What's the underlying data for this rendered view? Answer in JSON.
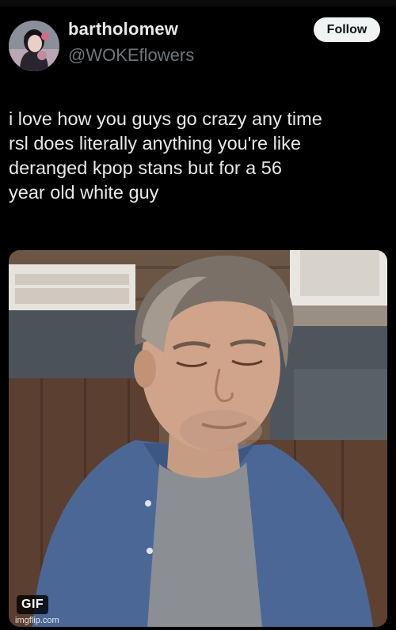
{
  "user": {
    "display_name": "bartholomew",
    "handle": "@WOKEflowers"
  },
  "follow_label": "Follow",
  "tweet": {
    "text": "i love how you guys go crazy any time\nrsl does literally anything you're like\nderanged kpop stans but for a 56\nyear old white guy"
  },
  "media": {
    "badge": "GIF",
    "watermark": "imgflip.com"
  },
  "colors": {
    "background": "#000000",
    "text": "#e7e9ea",
    "secondary_text": "#71767b",
    "follow_button_bg": "#eff3f4"
  }
}
